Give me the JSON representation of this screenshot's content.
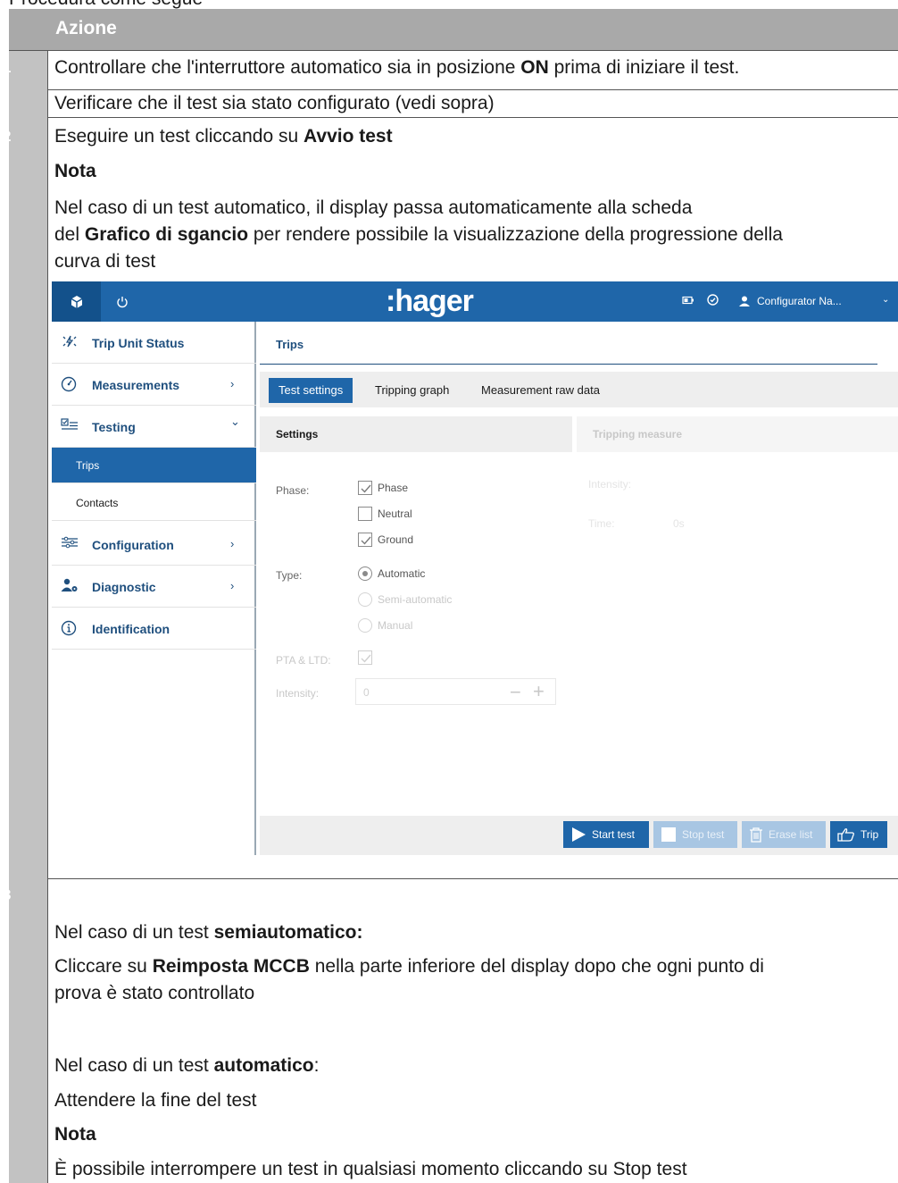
{
  "top_fragment": "Procedura come segue",
  "table": {
    "header": "Azione",
    "rows": [
      {
        "num": "1",
        "lines": [
          {
            "pre": "Controllare che l'interruttore automatico sia in posizione ",
            "bold": "ON",
            "post": " prima di iniziare il test."
          },
          {
            "pre": "Verificare che il test sia stato configurato (vedi sopra)",
            "bold": "",
            "post": ""
          }
        ]
      },
      {
        "num": "2",
        "l1_pre": "Eseguire un test cliccando su ",
        "l1_bold": "Avvio test",
        "nota": "Nota",
        "l3": "Nel caso di un test automatico, il display passa automaticamente alla scheda",
        "l4_pre": "del ",
        "l4_bold": "Grafico di sgancio",
        "l4_post": " per rendere possibile la visualizzazione della progressione della",
        "l5": "curva di test"
      },
      {
        "num": "3",
        "semi_pre": "Nel caso di un test ",
        "semi_bold": "semiautomatico:",
        "click_pre": "Cliccare su ",
        "click_bold": "Reimposta MCCB",
        "click_post": " nella parte inferiore del display dopo che ogni punto di",
        "click_l2": "prova è stato controllato",
        "auto_pre": "Nel caso di un test ",
        "auto_bold": "automatico",
        "auto_post": ":",
        "wait": "Attendere la fine del test",
        "nota": "Nota",
        "stop": "È possibile interrompere un test in qualsiasi momento cliccando su Stop test"
      }
    ]
  },
  "app": {
    "brand": ":hager",
    "user": "Configurator Na...",
    "colors": {
      "primary": "#1f66a9",
      "dark": "#13518b",
      "nav_text": "#1f4f7e"
    },
    "sidebar": {
      "items": [
        {
          "label": "Trip Unit Status",
          "icon": "trip-status-icon"
        },
        {
          "label": "Measurements",
          "icon": "gauge-icon",
          "chevron": "›"
        },
        {
          "label": "Testing",
          "icon": "checklist-icon",
          "chevron": "⌄"
        },
        {
          "label": "Trips",
          "active": true
        },
        {
          "label": "Contacts"
        },
        {
          "label": "Configuration",
          "icon": "sliders-icon",
          "chevron": "›"
        },
        {
          "label": "Diagnostic",
          "icon": "user-gear-icon",
          "chevron": "›"
        },
        {
          "label": "Identification",
          "icon": "info-icon"
        }
      ]
    },
    "main": {
      "title": "Trips",
      "tabs": [
        "Test settings",
        "Tripping graph",
        "Measurement raw data"
      ],
      "settings_header": "Settings",
      "measure_header": "Tripping measure",
      "phase_label": "Phase:",
      "phase_options": [
        {
          "label": "Phase",
          "checked": true
        },
        {
          "label": "Neutral",
          "checked": false
        },
        {
          "label": "Ground",
          "checked": true
        }
      ],
      "type_label": "Type:",
      "type_options": [
        {
          "label": "Automatic",
          "selected": true
        },
        {
          "label": "Semi-automatic",
          "selected": false
        },
        {
          "label": "Manual",
          "selected": false
        }
      ],
      "pta_label": "PTA & LTD:",
      "intensity_label": "Intensity:",
      "intensity_value": "0",
      "measure_intensity_label": "Intensity:",
      "measure_time_label": "Time:",
      "measure_time_value": "0s",
      "buttons": [
        "Start test",
        "Stop test",
        "Erase list",
        "Trip"
      ]
    }
  }
}
